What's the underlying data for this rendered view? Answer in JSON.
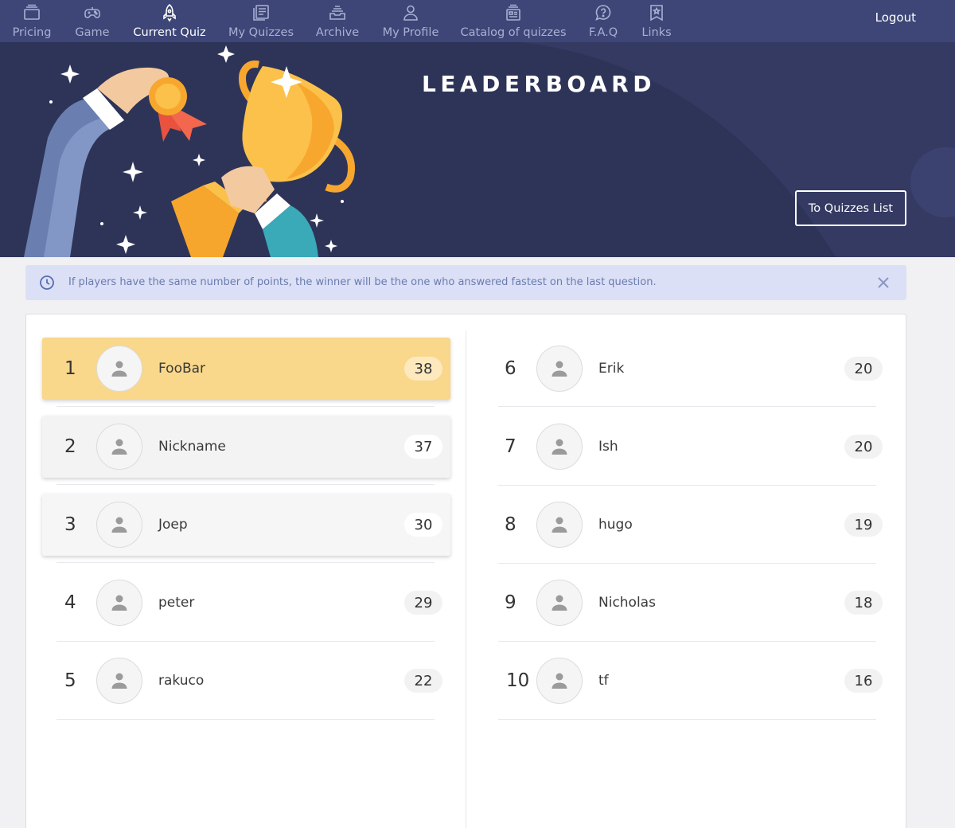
{
  "nav": {
    "items": [
      {
        "label": "Pricing",
        "icon": "pricing-icon"
      },
      {
        "label": "Game",
        "icon": "gamepad-icon"
      },
      {
        "label": "Current Quiz",
        "icon": "rocket-icon"
      },
      {
        "label": "My Quizzes",
        "icon": "quizzes-icon"
      },
      {
        "label": "Archive",
        "icon": "archive-icon"
      },
      {
        "label": "My Profile",
        "icon": "user-icon"
      },
      {
        "label": "Catalog of quizzes",
        "icon": "catalog-icon"
      },
      {
        "label": "F.A.Q",
        "icon": "faq-icon"
      },
      {
        "label": "Links",
        "icon": "bookmark-icon"
      }
    ],
    "active": "Current Quiz",
    "logout": "Logout"
  },
  "hero": {
    "title": "LEADERBOARD",
    "button": "To Quizzes List"
  },
  "alert": {
    "text": "If players have the same number of points, the winner will be the one who answered fastest on the last question."
  },
  "leaderboard": [
    {
      "rank": "1",
      "name": "FooBar",
      "score": "38"
    },
    {
      "rank": "2",
      "name": "Nickname",
      "score": "37"
    },
    {
      "rank": "3",
      "name": "Joep",
      "score": "30"
    },
    {
      "rank": "4",
      "name": "peter",
      "score": "29"
    },
    {
      "rank": "5",
      "name": "rakuco",
      "score": "22"
    },
    {
      "rank": "6",
      "name": "Erik",
      "score": "20"
    },
    {
      "rank": "7",
      "name": "Ish",
      "score": "20"
    },
    {
      "rank": "8",
      "name": "hugo",
      "score": "19"
    },
    {
      "rank": "9",
      "name": "Nicholas",
      "score": "18"
    },
    {
      "rank": "10",
      "name": "tf",
      "score": "16"
    }
  ],
  "colors": {
    "nav_bg": "#3d4677",
    "hero_bg": "#2e3458",
    "gold": "#f9d78b",
    "alert_bg": "#dbe0f6"
  }
}
